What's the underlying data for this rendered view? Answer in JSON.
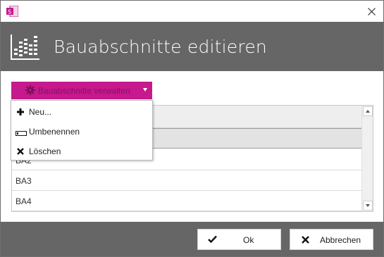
{
  "dialog": {
    "title": "Bauabschnitte editieren",
    "app_icon": "onenote-style-app-icon",
    "header_icon": "bar-chart-icon"
  },
  "toolbar": {
    "manage_label": "Bauabschnitte verwalten",
    "manage_icon": "gear-icon",
    "accent_color": "#c5198d"
  },
  "menu": {
    "items": [
      {
        "label": "Neu...",
        "icon": "plus-icon"
      },
      {
        "label": "Umbenennen",
        "icon": "rename-icon"
      },
      {
        "label": "Löschen",
        "icon": "x-icon"
      }
    ]
  },
  "list": {
    "rows": [
      {
        "label": ""
      },
      {
        "label": "BA2"
      },
      {
        "label": "BA3"
      },
      {
        "label": "BA4"
      }
    ]
  },
  "footer": {
    "ok_label": "Ok",
    "cancel_label": "Abbrechen",
    "background_color": "#666666"
  }
}
